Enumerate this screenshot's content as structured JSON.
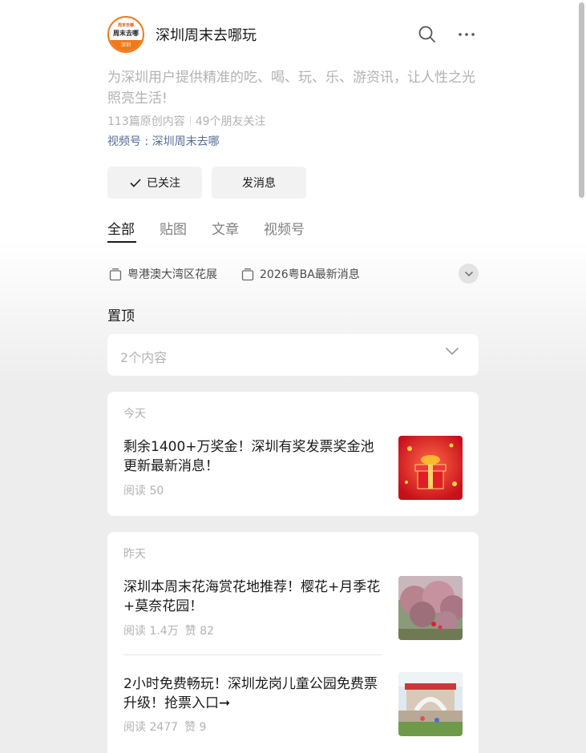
{
  "account": {
    "name": "深圳周末去哪玩",
    "avatar_text_top": "周末去哪",
    "avatar_text_mid": "周末去哪",
    "avatar_text_bottom": "深圳",
    "description": "为深圳用户提供精准的吃、喝、玩、乐、游资讯，让人性之光照亮生活!",
    "original_count": "113篇原创内容",
    "friends_following": "49个朋友关注",
    "channel_label": "视频号 : 深圳周末去哪"
  },
  "actions": {
    "followed_label": "已关注",
    "message_label": "发消息"
  },
  "tabs": [
    {
      "label": "全部",
      "active": true
    },
    {
      "label": "贴图",
      "active": false
    },
    {
      "label": "文章",
      "active": false
    },
    {
      "label": "视频号",
      "active": false
    }
  ],
  "collections": [
    {
      "label": "粤港澳大湾区花展"
    },
    {
      "label": "2026粤BA最新消息"
    }
  ],
  "pinned": {
    "title": "置顶",
    "summary": "2个内容"
  },
  "feed": [
    {
      "day": "今天",
      "articles": [
        {
          "title": "剩余1400+万奖金！深圳有奖发票奖金池更新最新消息！",
          "reads": "阅读 50",
          "likes": "",
          "thumb": "red-gift-box-image"
        }
      ]
    },
    {
      "day": "昨天",
      "articles": [
        {
          "title": "深圳本周末花海赏花地推荐！樱花+月季花+莫奈花园！",
          "reads": "阅读 1.4万",
          "likes": "赞 82",
          "thumb": "cherry-blossom-image"
        },
        {
          "title": "2小时免费畅玩！深圳龙岗儿童公园免费票升级！抢票入口➞",
          "reads": "阅读 2477",
          "likes": "赞 9",
          "thumb": "children-park-image"
        }
      ]
    }
  ],
  "colors": {
    "link": "#576b95",
    "muted": "#b2b2b2",
    "brand_orange": "#f07a1a"
  }
}
